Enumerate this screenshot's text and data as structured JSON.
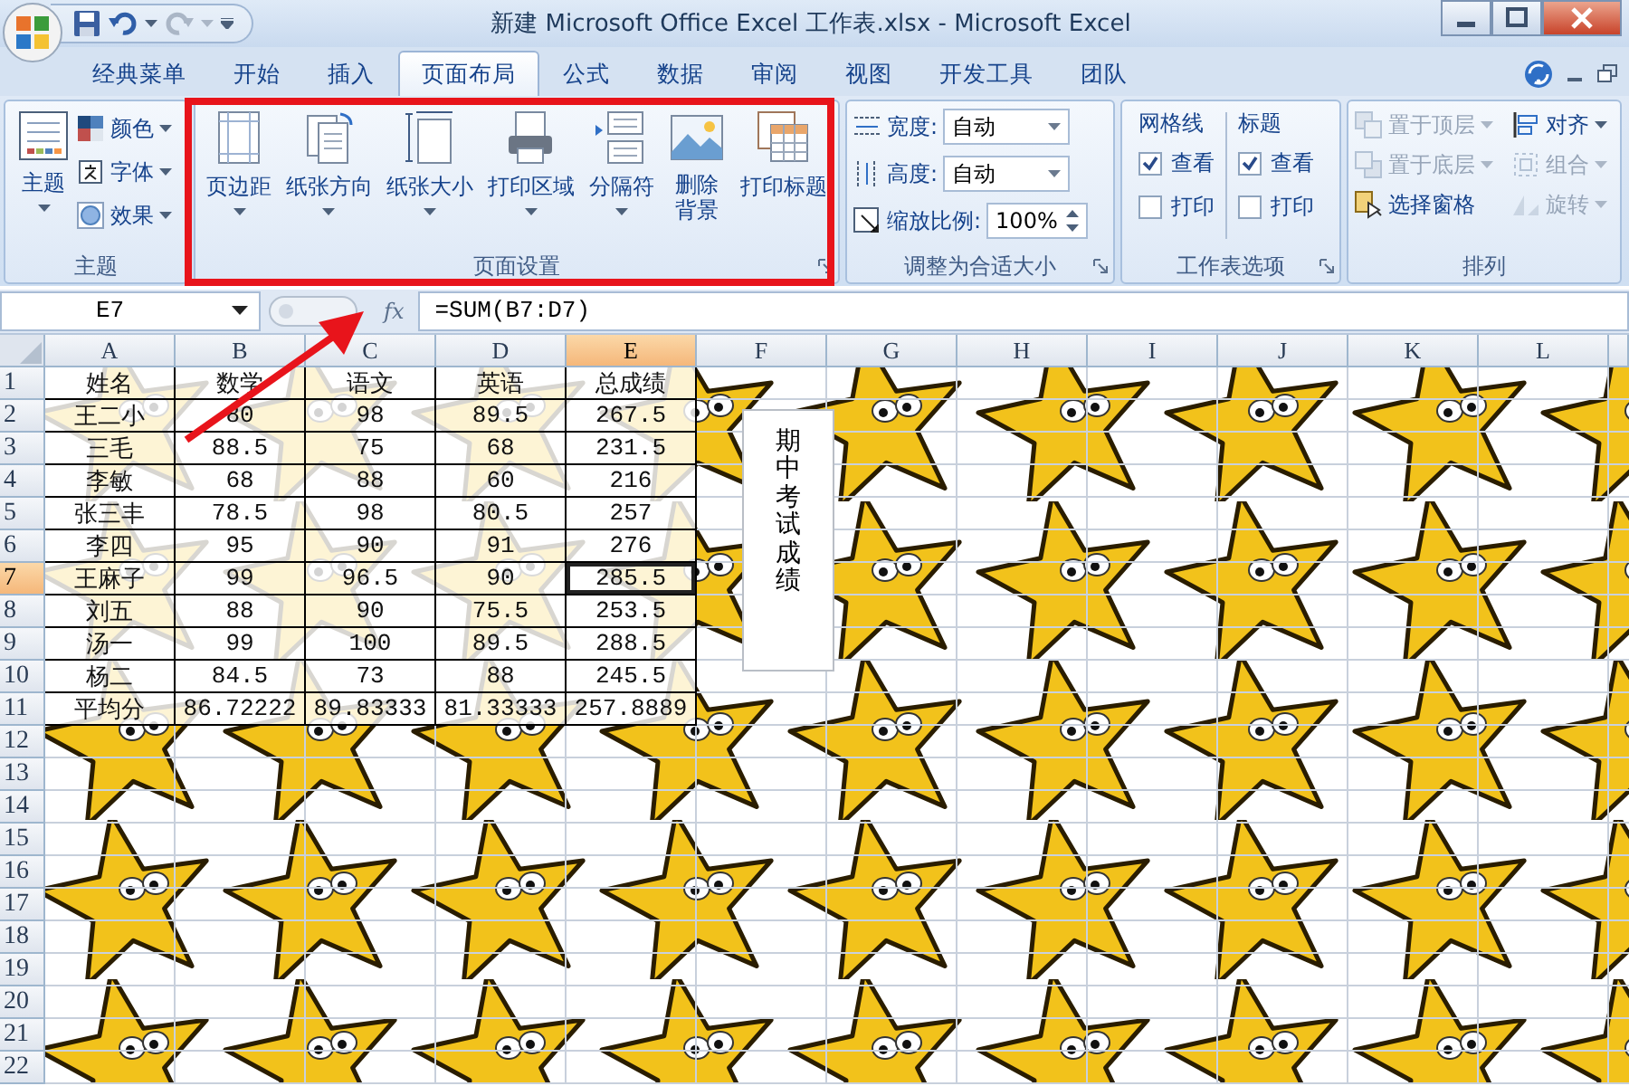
{
  "window": {
    "title": "新建 Microsoft Office Excel 工作表.xlsx - Microsoft Excel"
  },
  "tabs": [
    {
      "label": "经典菜单",
      "selected": false
    },
    {
      "label": "开始",
      "selected": false
    },
    {
      "label": "插入",
      "selected": false
    },
    {
      "label": "页面布局",
      "selected": true
    },
    {
      "label": "公式",
      "selected": false
    },
    {
      "label": "数据",
      "selected": false
    },
    {
      "label": "审阅",
      "selected": false
    },
    {
      "label": "视图",
      "selected": false
    },
    {
      "label": "开发工具",
      "selected": false
    },
    {
      "label": "团队",
      "selected": false
    }
  ],
  "ribbon": {
    "groups": [
      {
        "kind": "theme",
        "label": "主题",
        "launcher": false,
        "big_button": "主题",
        "items": [
          "颜色",
          "字体",
          "效果"
        ]
      },
      {
        "kind": "page_setup",
        "label": "页面设置",
        "launcher": true,
        "buttons": [
          {
            "label": "页边距",
            "dropdown": true
          },
          {
            "label": "纸张方向",
            "dropdown": true
          },
          {
            "label": "纸张大小",
            "dropdown": true
          },
          {
            "label": "打印区域",
            "dropdown": true
          },
          {
            "label": "分隔符",
            "dropdown": true
          },
          {
            "label": "删除背景",
            "dropdown": false
          },
          {
            "label": "打印标题",
            "dropdown": false
          }
        ]
      },
      {
        "kind": "scale",
        "label": "调整为合适大小",
        "launcher": true,
        "fields": [
          {
            "kind": "dropdown",
            "label": "宽度:",
            "value": "自动"
          },
          {
            "kind": "dropdown",
            "label": "高度:",
            "value": "自动"
          },
          {
            "kind": "spinner",
            "label": "缩放比例:",
            "value": "100%"
          }
        ]
      },
      {
        "kind": "sheet_options",
        "label": "工作表选项",
        "launcher": true,
        "columns": [
          {
            "heading": "网格线",
            "options": [
              {
                "label": "查看",
                "checked": true
              },
              {
                "label": "打印",
                "checked": false
              }
            ]
          },
          {
            "heading": "标题",
            "options": [
              {
                "label": "查看",
                "checked": true
              },
              {
                "label": "打印",
                "checked": false
              }
            ]
          }
        ]
      },
      {
        "kind": "arrange",
        "label": "排列",
        "launcher": false,
        "items": [
          {
            "label": "置于顶层",
            "disabled": true,
            "dropdown": true
          },
          {
            "label": "对齐",
            "disabled": false,
            "dropdown": true
          },
          {
            "label": "置于底层",
            "disabled": true,
            "dropdown": true
          },
          {
            "label": "组合",
            "disabled": true,
            "dropdown": true
          },
          {
            "label": "选择窗格",
            "disabled": false,
            "dropdown": false
          },
          {
            "label": "旋转",
            "disabled": true,
            "dropdown": true
          }
        ]
      }
    ]
  },
  "formula_bar": {
    "name_box": "E7",
    "function_label": "fx",
    "formula": "=SUM(B7:D7)"
  },
  "sheet": {
    "columns": [
      {
        "label": "A",
        "selected": false
      },
      {
        "label": "B",
        "selected": false
      },
      {
        "label": "C",
        "selected": false
      },
      {
        "label": "D",
        "selected": false
      },
      {
        "label": "E",
        "selected": true
      },
      {
        "label": "F",
        "selected": false
      },
      {
        "label": "G",
        "selected": false
      },
      {
        "label": "H",
        "selected": false
      },
      {
        "label": "I",
        "selected": false
      },
      {
        "label": "J",
        "selected": false
      },
      {
        "label": "K",
        "selected": false
      },
      {
        "label": "L",
        "selected": false
      }
    ],
    "rows": [
      {
        "label": "1",
        "selected": false
      },
      {
        "label": "2",
        "selected": false
      },
      {
        "label": "3",
        "selected": false
      },
      {
        "label": "4",
        "selected": false
      },
      {
        "label": "5",
        "selected": false
      },
      {
        "label": "6",
        "selected": false
      },
      {
        "label": "7",
        "selected": true
      },
      {
        "label": "8",
        "selected": false
      },
      {
        "label": "9",
        "selected": false
      },
      {
        "label": "10",
        "selected": false
      },
      {
        "label": "11",
        "selected": false
      },
      {
        "label": "12",
        "selected": false
      },
      {
        "label": "13",
        "selected": false
      },
      {
        "label": "14",
        "selected": false
      },
      {
        "label": "15",
        "selected": false
      },
      {
        "label": "16",
        "selected": false
      },
      {
        "label": "17",
        "selected": false
      },
      {
        "label": "18",
        "selected": false
      },
      {
        "label": "19",
        "selected": false
      },
      {
        "label": "20",
        "selected": false
      },
      {
        "label": "21",
        "selected": false
      },
      {
        "label": "22",
        "selected": false
      }
    ],
    "cells": [
      [
        "姓名",
        "数学",
        "语文",
        "英语",
        "总成绩"
      ],
      [
        "王二小",
        "80",
        "98",
        "89.5",
        "267.5"
      ],
      [
        "三毛",
        "88.5",
        "75",
        "68",
        "231.5"
      ],
      [
        "李敏",
        "68",
        "88",
        "60",
        "216"
      ],
      [
        "张三丰",
        "78.5",
        "98",
        "80.5",
        "257"
      ],
      [
        "李四",
        "95",
        "90",
        "91",
        "276"
      ],
      [
        "王麻子",
        "99",
        "96.5",
        "90",
        "285.5"
      ],
      [
        "刘五",
        "88",
        "90",
        "75.5",
        "253.5"
      ],
      [
        "汤一",
        "99",
        "100",
        "89.5",
        "288.5"
      ],
      [
        "杨二",
        "84.5",
        "73",
        "88",
        "245.5"
      ],
      [
        "平均分",
        "86.72222",
        "89.83333",
        "81.33333",
        "257.8889"
      ]
    ],
    "text_box": "期中考试成绩"
  },
  "annotations": {
    "highlight_box": true,
    "arrow": true
  }
}
